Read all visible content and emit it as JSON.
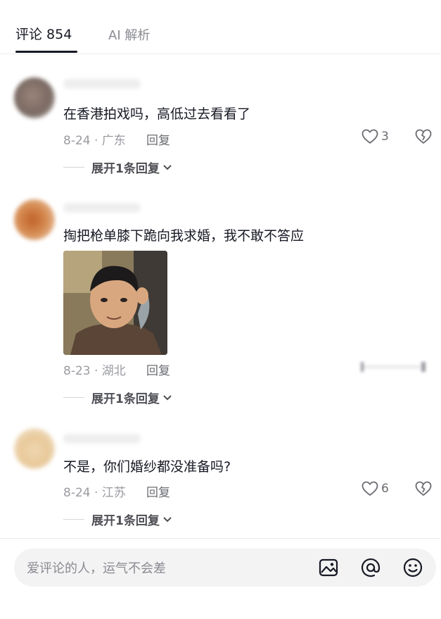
{
  "tabs": {
    "comments": "评论 854",
    "ai": "AI 解析"
  },
  "comments": [
    {
      "text": "在香港拍戏吗，高低过去看看了",
      "date_location": "8-24 · 广东",
      "reply": "回复",
      "likes": "3",
      "expand": "展开1条回复"
    },
    {
      "text": "掏把枪单膝下跪向我求婚，我不敢不答应",
      "date_location": "8-23 · 湖北",
      "reply": "回复",
      "expand": "展开1条回复"
    },
    {
      "text": "不是，你们婚纱都没准备吗?",
      "date_location": "8-24 · 江苏",
      "reply": "回复",
      "likes": "6",
      "expand": "展开1条回复"
    }
  ],
  "input": {
    "placeholder": "爱评论的人，运气不会差"
  },
  "icons": {
    "heart": "heart-icon",
    "broken_heart": "broken-heart-icon",
    "chevron": "chevron-down-icon",
    "image": "image-icon",
    "at": "at-icon",
    "emoji": "emoji-icon"
  }
}
